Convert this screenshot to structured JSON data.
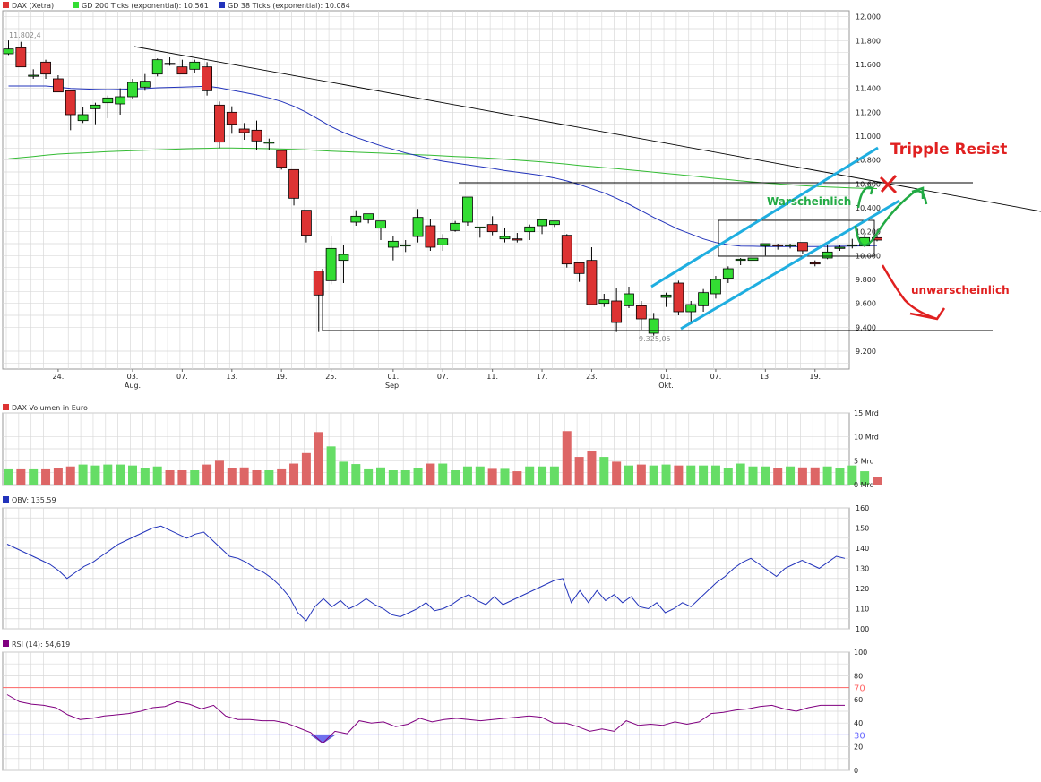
{
  "colors": {
    "up": "#33dd33",
    "down": "#dd3333",
    "grid": "#d9d9d9",
    "ma200": "#33bb33",
    "ma38": "#2233bb",
    "channel": "#1faee0",
    "annotation_red": "#e02020",
    "annotation_green": "#22aa44",
    "rsi_line": "#800080",
    "rsi70": "#ff6666",
    "rsi30": "#6666ff"
  },
  "legend": {
    "price": [
      "DAX (Xetra)",
      "GD 200 Ticks (exponential): 10.561",
      "GD 38 Ticks (exponential): 10.084"
    ],
    "volume": "DAX Volumen in Euro",
    "obv": "OBV: 135,59",
    "rsi": "RSI (14): 54,619"
  },
  "annotations": {
    "tripple_resist": "Tripple Resist",
    "warscheinlich": "Warscheinlich",
    "unwarscheinlich": "unwarscheinlich",
    "high_label": "11.802,4",
    "low_label": "9.325,05"
  },
  "chart_data": [
    {
      "type": "candlestick",
      "name": "price",
      "x_tick_labels": [
        "24.",
        "03.",
        "07.",
        "13.",
        "19.",
        "25.",
        "01.",
        "07.",
        "11.",
        "17.",
        "23.",
        "01.",
        "07.",
        "13.",
        "19."
      ],
      "x_tick_index": [
        4,
        10,
        14,
        18,
        22,
        26,
        31,
        35,
        39,
        43,
        47,
        53,
        57,
        61,
        65
      ],
      "month_labels": [
        {
          "label": "Aug.",
          "index": 10
        },
        {
          "label": "Sep.",
          "index": 31
        },
        {
          "label": "Okt.",
          "index": 53
        }
      ],
      "ylim": [
        9050,
        12050
      ],
      "y_ticks": [
        9200,
        9400,
        9600,
        9800,
        10000,
        10200,
        10400,
        10600,
        10800,
        11000,
        11200,
        11400,
        11600,
        11800,
        12000
      ],
      "y_tick_labels": [
        "9.200",
        "9.400",
        "9.600",
        "9.800",
        "10.000",
        "10.200",
        "10.400",
        "10.600",
        "10.800",
        "11.000",
        "11.200",
        "11.400",
        "11.600",
        "11.800",
        "12.000"
      ],
      "ohlc": [
        [
          11690,
          11802,
          11680,
          11730
        ],
        [
          11740,
          11790,
          11620,
          11580
        ],
        [
          11510,
          11560,
          11480,
          11510
        ],
        [
          11620,
          11640,
          11480,
          11520
        ],
        [
          11480,
          11510,
          11390,
          11370
        ],
        [
          11380,
          11390,
          11050,
          11180
        ],
        [
          11130,
          11240,
          11110,
          11180
        ],
        [
          11230,
          11280,
          11100,
          11260
        ],
        [
          11280,
          11340,
          11150,
          11320
        ],
        [
          11270,
          11400,
          11180,
          11330
        ],
        [
          11330,
          11480,
          11310,
          11450
        ],
        [
          11410,
          11520,
          11380,
          11460
        ],
        [
          11520,
          11650,
          11500,
          11640
        ],
        [
          11610,
          11660,
          11590,
          11600
        ],
        [
          11580,
          11640,
          11540,
          11520
        ],
        [
          11560,
          11640,
          11530,
          11620
        ],
        [
          11580,
          11620,
          11340,
          11380
        ],
        [
          11260,
          11290,
          10900,
          10950
        ],
        [
          11200,
          11250,
          11020,
          11100
        ],
        [
          11060,
          11110,
          10970,
          11030
        ],
        [
          11050,
          11130,
          10880,
          10960
        ],
        [
          10950,
          10980,
          10880,
          10950
        ],
        [
          10880,
          10870,
          10720,
          10740
        ],
        [
          10720,
          10660,
          10420,
          10480
        ],
        [
          10380,
          10260,
          10110,
          10170
        ],
        [
          9870,
          9820,
          9360,
          9670
        ],
        [
          9790,
          10160,
          9760,
          10060
        ],
        [
          9960,
          10090,
          9770,
          10010
        ],
        [
          10280,
          10380,
          10250,
          10330
        ],
        [
          10300,
          10340,
          10270,
          10350
        ],
        [
          10230,
          10270,
          10130,
          10290
        ],
        [
          10070,
          10160,
          9960,
          10120
        ],
        [
          10080,
          10130,
          10030,
          10090
        ],
        [
          10160,
          10390,
          10110,
          10320
        ],
        [
          10250,
          10310,
          10040,
          10070
        ],
        [
          10090,
          10180,
          10040,
          10140
        ],
        [
          10210,
          10290,
          10200,
          10270
        ],
        [
          10280,
          10490,
          10250,
          10490
        ],
        [
          10240,
          10240,
          10150,
          10240
        ],
        [
          10260,
          10330,
          10170,
          10200
        ],
        [
          10140,
          10230,
          10110,
          10160
        ],
        [
          10140,
          10190,
          10110,
          10130
        ],
        [
          10200,
          10260,
          10130,
          10240
        ],
        [
          10250,
          10310,
          10180,
          10300
        ],
        [
          10260,
          10290,
          10240,
          10290
        ],
        [
          10170,
          10180,
          9900,
          9930
        ],
        [
          9940,
          9920,
          9780,
          9850
        ],
        [
          9960,
          10070,
          9590,
          9590
        ],
        [
          9600,
          9680,
          9570,
          9630
        ],
        [
          9620,
          9730,
          9360,
          9440
        ],
        [
          9580,
          9740,
          9560,
          9680
        ],
        [
          9580,
          9620,
          9380,
          9470
        ],
        [
          9350,
          9520,
          9330,
          9470
        ],
        [
          9650,
          9690,
          9570,
          9670
        ],
        [
          9770,
          9790,
          9500,
          9530
        ],
        [
          9530,
          9620,
          9430,
          9590
        ],
        [
          9580,
          9720,
          9530,
          9690
        ],
        [
          9680,
          9830,
          9640,
          9800
        ],
        [
          9810,
          9910,
          9770,
          9890
        ],
        [
          9960,
          9980,
          9920,
          9970
        ],
        [
          9960,
          9990,
          9940,
          9980
        ],
        [
          10080,
          10100,
          10000,
          10100
        ],
        [
          10090,
          10100,
          10050,
          10080
        ],
        [
          10080,
          10100,
          10060,
          10090
        ],
        [
          10110,
          10100,
          10010,
          10040
        ],
        [
          9940,
          9960,
          9910,
          9930
        ],
        [
          9980,
          10090,
          9970,
          10030
        ],
        [
          10060,
          10090,
          10040,
          10070
        ],
        [
          10090,
          10140,
          10060,
          10090
        ],
        [
          10080,
          10180,
          10070,
          10150
        ],
        [
          10150,
          10190,
          10120,
          10130
        ]
      ],
      "ma200": [
        10810,
        10820,
        10830,
        10840,
        10850,
        10855,
        10860,
        10865,
        10870,
        10875,
        10878,
        10882,
        10886,
        10890,
        10893,
        10896,
        10898,
        10900,
        10900,
        10899,
        10897,
        10895,
        10892,
        10889,
        10885,
        10880,
        10875,
        10870,
        10866,
        10862,
        10858,
        10854,
        10850,
        10845,
        10840,
        10835,
        10830,
        10825,
        10820,
        10814,
        10808,
        10800,
        10792,
        10784,
        10775,
        10765,
        10755,
        10746,
        10737,
        10728,
        10718,
        10708,
        10698,
        10688,
        10678,
        10668,
        10657,
        10646,
        10636,
        10626,
        10617,
        10608,
        10600,
        10593,
        10586,
        10580,
        10575,
        10570,
        10566,
        10563,
        10561
      ],
      "ma38": [
        11420,
        11420,
        11420,
        11420,
        11410,
        11400,
        11395,
        11392,
        11390,
        11392,
        11395,
        11398,
        11405,
        11408,
        11410,
        11415,
        11418,
        11405,
        11385,
        11365,
        11345,
        11320,
        11290,
        11250,
        11200,
        11140,
        11080,
        11030,
        10990,
        10955,
        10920,
        10890,
        10860,
        10835,
        10810,
        10790,
        10775,
        10760,
        10745,
        10730,
        10712,
        10698,
        10685,
        10670,
        10650,
        10625,
        10595,
        10560,
        10525,
        10480,
        10430,
        10375,
        10320,
        10270,
        10220,
        10180,
        10140,
        10110,
        10090,
        10080,
        10078,
        10076,
        10076,
        10075,
        10076,
        10076,
        10077,
        10078,
        10080,
        10082,
        10084
      ]
    },
    {
      "type": "bar",
      "name": "volume",
      "ylim": [
        0,
        15
      ],
      "y_ticks": [
        0,
        5,
        10,
        15
      ],
      "y_tick_labels": [
        "0 Mrd",
        "5 Mrd",
        "10 Mrd",
        "15 Mrd"
      ],
      "values": [
        3.2,
        3.2,
        3.2,
        3.2,
        3.4,
        3.8,
        4.2,
        4.0,
        4.2,
        4.2,
        4.0,
        3.4,
        3.8,
        3.0,
        3.0,
        3.0,
        4.2,
        5.0,
        3.4,
        3.6,
        3.0,
        3.0,
        3.2,
        4.4,
        6.6,
        11.0,
        8.0,
        4.8,
        4.3,
        3.2,
        3.6,
        3.0,
        3.0,
        3.4,
        4.4,
        4.4,
        3.0,
        3.8,
        3.8,
        3.3,
        3.3,
        2.8,
        3.8,
        3.8,
        3.8,
        11.2,
        5.8,
        7.0,
        5.8,
        4.8,
        4.0,
        4.2,
        4.0,
        4.2,
        4.0,
        4.0,
        4.0,
        4.0,
        3.4,
        4.4,
        3.8,
        3.8,
        3.4,
        3.8,
        3.6,
        3.6,
        3.8,
        3.4,
        4.0,
        2.8,
        1.5
      ]
    },
    {
      "type": "line",
      "name": "OBV",
      "ylim": [
        100,
        160
      ],
      "y_ticks": [
        100,
        110,
        120,
        130,
        140,
        150,
        160
      ],
      "y_tick_labels": [
        "100",
        "110",
        "120",
        "130",
        "140",
        "150",
        "160"
      ],
      "values": [
        142,
        140,
        138,
        136,
        134,
        132,
        129,
        125,
        128,
        131,
        133,
        136,
        139,
        142,
        144,
        146,
        148,
        150,
        151,
        149,
        147,
        145,
        147,
        148,
        144,
        140,
        136,
        135,
        133,
        130,
        128,
        125,
        121,
        116,
        108,
        104,
        111,
        115,
        111,
        114,
        110,
        112,
        115,
        112,
        110,
        107,
        106,
        108,
        110,
        113,
        109,
        110,
        112,
        115,
        117,
        114,
        112,
        116,
        112,
        114,
        116,
        118,
        120,
        122,
        124,
        125,
        113,
        119,
        113,
        119,
        114,
        117,
        113,
        116,
        111,
        110,
        113,
        108,
        110,
        113,
        111,
        115,
        119,
        123,
        126,
        130,
        133,
        135,
        132,
        129,
        126,
        130,
        132,
        134,
        132,
        130,
        133,
        136,
        135
      ]
    },
    {
      "type": "line",
      "name": "RSI",
      "ylim": [
        0,
        100
      ],
      "y_ticks": [
        0,
        20,
        40,
        60,
        80,
        100
      ],
      "y_tick_labels": [
        "0",
        "20",
        "40",
        "60",
        "80",
        "100"
      ],
      "levels": [
        {
          "value": 70,
          "label": "70"
        },
        {
          "value": 30,
          "label": "30"
        }
      ],
      "values": [
        64,
        58,
        56,
        55,
        53,
        47,
        43,
        44,
        46,
        47,
        48,
        50,
        53,
        54,
        58,
        56,
        52,
        55,
        46,
        43,
        43,
        42,
        42,
        40,
        36,
        32,
        23,
        33,
        31,
        42,
        40,
        41,
        37,
        39,
        44,
        41,
        43,
        44,
        43,
        42,
        43,
        44,
        45,
        46,
        45,
        40,
        40,
        37,
        33,
        35,
        33,
        42,
        38,
        39,
        38,
        41,
        39,
        41,
        48,
        49,
        51,
        52,
        54,
        55,
        52,
        50,
        53,
        55,
        55,
        55
      ]
    }
  ]
}
